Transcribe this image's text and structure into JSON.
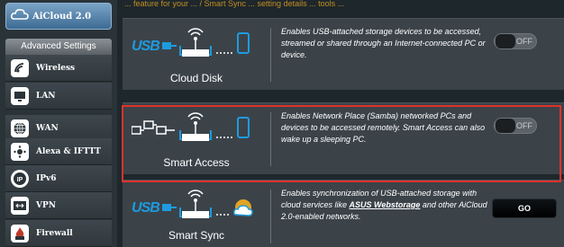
{
  "sidebar": {
    "aicloud_label": "AiCloud 2.0",
    "adv_header": "Advanced Settings",
    "items": [
      {
        "label": "Wireless",
        "icon": "wifi-icon"
      },
      {
        "label": "LAN",
        "icon": "monitor-icon"
      },
      {
        "label": "WAN",
        "icon": "globe-icon"
      },
      {
        "label": "Alexa & IFTTT",
        "icon": "alexa-icon"
      },
      {
        "label": "IPv6",
        "icon": "ipv6-icon"
      },
      {
        "label": "VPN",
        "icon": "vpn-icon"
      },
      {
        "label": "Firewall",
        "icon": "firewall-icon"
      }
    ]
  },
  "main": {
    "top_strip_text": "... feature for your ... / Smart Sync ... setting details ... tools ...",
    "cards": [
      {
        "title": "Cloud Disk",
        "usb_badge": "USB",
        "description": "Enables USB-attached storage devices to be accessed, streamed or shared through an Internet-connected PC or device.",
        "toggle_state": "OFF"
      },
      {
        "title": "Smart Access",
        "description": "Enables Network Place (Samba) networked PCs and devices to be accessed remotely. Smart Access can also wake up a sleeping PC.",
        "toggle_state": "OFF"
      },
      {
        "title": "Smart Sync",
        "usb_badge": "USB",
        "description_pre": "Enables synchronization of USB-attached storage with cloud services like ",
        "description_link": "ASUS Webstorage",
        "description_post": " and other AiCloud 2.0-enabled networks.",
        "button_label": "GO"
      }
    ]
  },
  "colors": {
    "accent_blue": "#1e9be0",
    "highlight_red": "#e0312b",
    "card_bg": "#3b4349"
  }
}
